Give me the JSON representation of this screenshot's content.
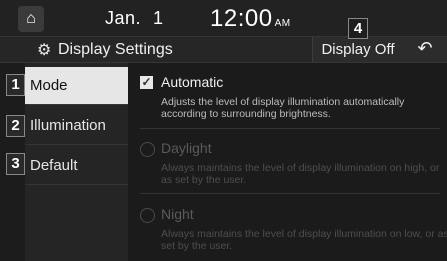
{
  "status_bar": {
    "date_month": "Jan.",
    "date_day": "1",
    "time": "12:00",
    "ampm": "AM"
  },
  "header": {
    "title": "Display Settings",
    "display_off_label": "Display Off"
  },
  "callouts": [
    "1",
    "2",
    "3",
    "4"
  ],
  "sidebar": {
    "items": [
      {
        "label": "Mode",
        "active": true
      },
      {
        "label": "Illumination",
        "active": false
      },
      {
        "label": "Default",
        "active": false
      }
    ]
  },
  "options": [
    {
      "title": "Automatic",
      "description": "Adjusts the level of display illumination automatically according to surrounding brightness.",
      "selected": true,
      "enabled": true
    },
    {
      "title": "Daylight",
      "description": "Always maintains the level of display illumination on high, or as set by the user.",
      "selected": false,
      "enabled": false
    },
    {
      "title": "Night",
      "description": "Always maintains the level of display illumination on low, or as set by the user.",
      "selected": false,
      "enabled": false
    }
  ],
  "icons": {
    "home": "home-icon",
    "settings": "gear-icon",
    "back": "back-arrow-icon",
    "checkbox": "checkbox-checked-icon",
    "radio": "radio-unselected-icon"
  },
  "colors": {
    "background": "#1b1b1b",
    "active_tab": "#e6e6e6",
    "disabled_text": "#5a5a5a"
  }
}
